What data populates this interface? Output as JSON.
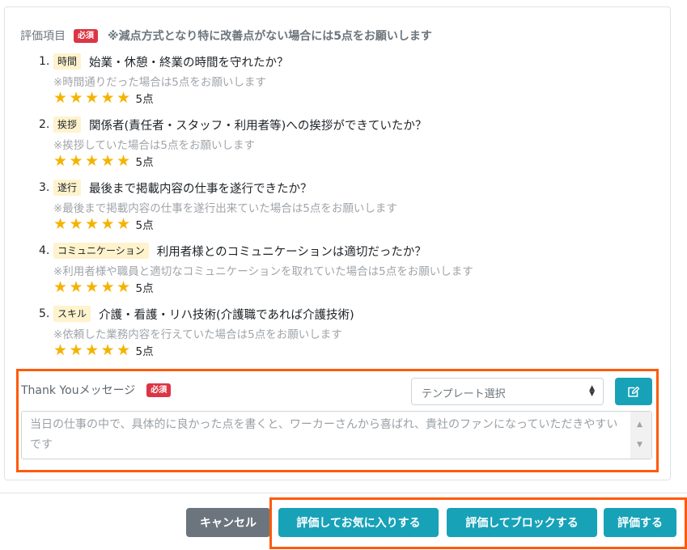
{
  "evaluation": {
    "label": "評価項目",
    "required_badge": "必須",
    "note": "※減点方式となり特に改善点がない場合には5点をお願いします",
    "items": [
      {
        "num": "1.",
        "tag": "時間",
        "question": "始業・休憩・終業の時間を守れたか？",
        "hint": "※時間通りだった場合は5点をお願いします",
        "score": "5点",
        "stars": 5
      },
      {
        "num": "2.",
        "tag": "挨拶",
        "question": "関係者(責任者・スタッフ・利用者等)への挨拶ができていたか？",
        "hint": "※挨拶していた場合は5点をお願いします",
        "score": "5点",
        "stars": 5
      },
      {
        "num": "3.",
        "tag": "遂行",
        "question": "最後まで掲載内容の仕事を遂行できたか？",
        "hint": "※最後まで掲載内容の仕事を遂行出来ていた場合は5点をお願いします",
        "score": "5点",
        "stars": 5
      },
      {
        "num": "4.",
        "tag": "コミュニケーション",
        "question": "利用者様とのコミュニケーションは適切だったか？",
        "hint": "※利用者様や職員と適切なコミュニケーションを取れていた場合は5点をお願いします",
        "score": "5点",
        "stars": 5
      },
      {
        "num": "5.",
        "tag": "スキル",
        "question": "介護・看護・リハ技術(介護職であれば介護技術)",
        "hint": "※依頼した業務内容を行えていた場合は5点をお願いします",
        "score": "5点",
        "stars": 5
      }
    ]
  },
  "message": {
    "label": "Thank Youメッセージ",
    "required_badge": "必須",
    "template_select": "テンプレート選択",
    "placeholder": "当日の仕事の中で、具体的に良かった点を書くと、ワーカーさんから喜ばれ、貴社のファンになっていただきやすいです"
  },
  "buttons": {
    "cancel": "キャンセル",
    "favorite": "評価してお気に入りする",
    "block": "評価してブロックする",
    "submit": "評価する"
  },
  "icons": {
    "star": "star-icon",
    "edit": "edit-icon",
    "select_arrow": "sort-arrows-icon"
  },
  "colors": {
    "accent": "#17a2b8",
    "required": "#dc3545",
    "star": "#f5b301",
    "tag_bg": "#fff3cd",
    "highlight": "#ff5a0a",
    "cancel": "#6c757d"
  }
}
